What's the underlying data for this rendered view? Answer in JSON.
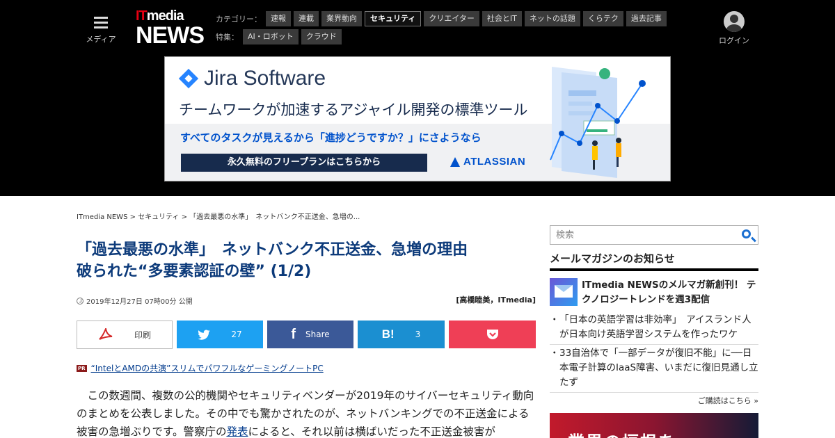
{
  "header": {
    "menu_label": "メディア",
    "logo_it": "IT",
    "logo_media": "media",
    "logo_news": "NEWS",
    "category_label": "カテゴリー：",
    "categories": [
      "速報",
      "連載",
      "業界動向",
      "セキュリティ",
      "クリエイター",
      "社会とIT",
      "ネットの話題",
      "くらテク",
      "過去記事"
    ],
    "active_category": "セキュリティ",
    "feature_label": "特集：",
    "features": [
      "AI・ロボット",
      "クラウド"
    ],
    "login_label": "ログイン"
  },
  "ad": {
    "brand": "Jira Software",
    "headline": "チームワークが加速するアジャイル開発の標準ツール",
    "subline": "すべてのタスクが見えるから「進捗どうですか？」にさようなら",
    "cta": "永久無料のフリープランはこちらから",
    "sponsor": "ATLASSIAN"
  },
  "article": {
    "breadcrumb": "ITmedia NEWS > セキュリティ > 「過去最悪の水準」　ネットバンク不正送金、急増の...",
    "title_line1": "「過去最悪の水準」　ネットバンク不正送金、急増の理由",
    "title_line2": "破られた“多要素認証の壁” (1/2)",
    "date": "2019年12月27日 07時00分 公開",
    "author": "[高橋睦美，ITmedia]",
    "share": {
      "print": "印刷",
      "twitter_count": "27",
      "facebook": "Share",
      "hatena_count": "3"
    },
    "pr_tag": "PR",
    "pr_link": "“IntelとAMDの共演”スリムでパワフルなゲーミングノートPC",
    "body_part1": "この数週間、複数の公的機関やセキュリティベンダーが2019年のサイバーセキュリティ動向のまとめを公表しました。その中でも驚かされたのが、ネットバンキングでの不正送金による被害の急増ぶりです。警察庁の",
    "body_link": "発表",
    "body_part2": "によると、それ以前は横ばいだった不正送金被害が"
  },
  "sidebar": {
    "search_placeholder": "検索",
    "mailmag_title": "メールマガジンのお知らせ",
    "mailmag_feature": "ITmedia NEWSのメルマガ新創刊！ テクノロジートレンドを週3配信",
    "mailmag_items": [
      "「日本の英語学習は非効率」　アイスランド人が日本向け英語学習システムを作ったワケ",
      "33自治体で「一部データが復旧不能」に──日本電子計算のIaaS障害、いまだに復旧見通し立たず"
    ],
    "more_link": "ご購読はこちら »",
    "ad_text": "業界の垣根を"
  },
  "colors": {
    "header_bg": "#000000",
    "title_blue": "#0c3a7a",
    "twitter": "#1da1f2",
    "facebook": "#3b5998",
    "hatena": "#1b8fd1",
    "pocket": "#ef3f56",
    "logo_red": "#e60012"
  }
}
